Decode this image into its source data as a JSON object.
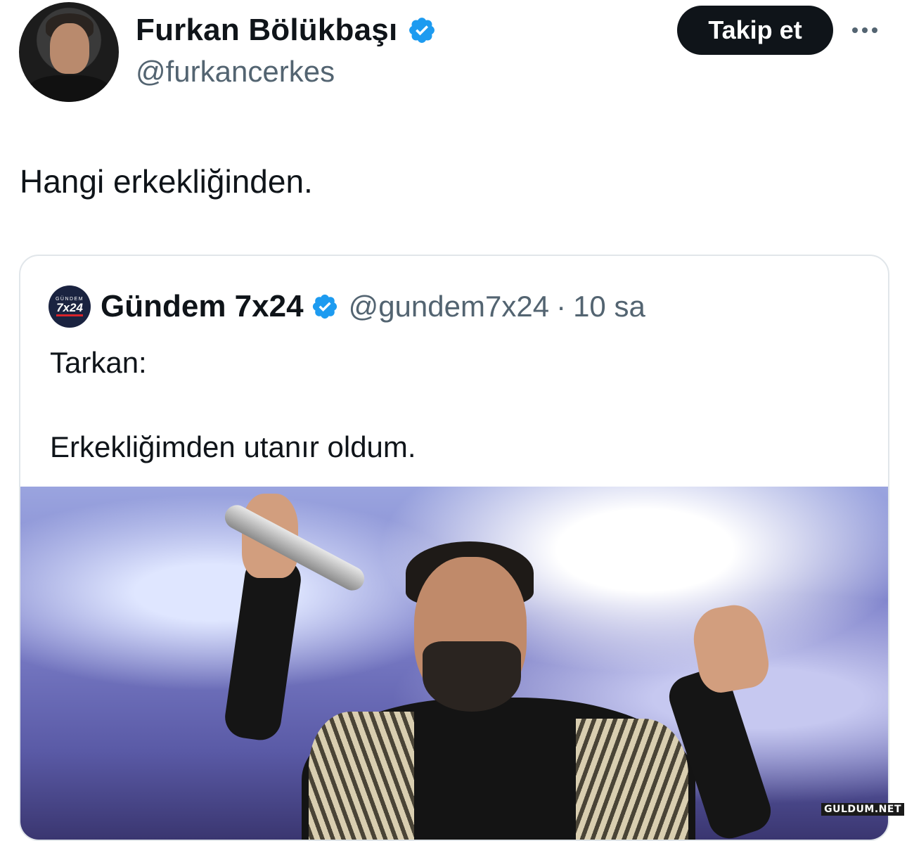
{
  "author": {
    "name": "Furkan Bölükbaşı",
    "handle": "@furkancerkes",
    "verified": true
  },
  "follow_label": "Takip et",
  "more_icon": "more-horizontal-icon",
  "tweet": {
    "text": "Hangi erkekliğinden."
  },
  "quoted": {
    "avatar_small": "GÜNDEM",
    "avatar_big": "7x24",
    "name": "Gündem 7x24",
    "handle": "@gundem7x24",
    "separator": "·",
    "time": "10 sa",
    "text": "Tarkan:\n\nErkekliğimden utanır oldum.",
    "verified": true
  },
  "watermark": "GULDUM.NET",
  "colors": {
    "verified_blue": "#1d9bf0",
    "secondary_text": "#536471",
    "button_bg": "#0f1419"
  }
}
